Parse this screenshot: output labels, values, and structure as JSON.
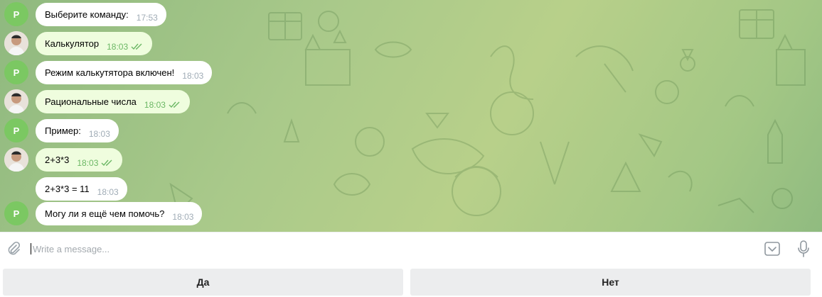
{
  "chat": {
    "messages": [
      {
        "from": "bot",
        "avatar_letter": "P",
        "text": "Выберите команду:",
        "time": "17:53"
      },
      {
        "from": "user",
        "text": "Калькулятор",
        "time": "18:03",
        "status": "read"
      },
      {
        "from": "bot",
        "avatar_letter": "P",
        "text": "Режим калькутятора включен!",
        "time": "18:03"
      },
      {
        "from": "user",
        "text": "Рациональные числа",
        "time": "18:03",
        "status": "read"
      },
      {
        "from": "bot",
        "avatar_letter": "P",
        "text": "Пример:",
        "time": "18:03"
      },
      {
        "from": "user",
        "text": "2+3*3",
        "time": "18:03",
        "status": "read"
      },
      {
        "from": "bot",
        "avatar_letter": "",
        "text": "2+3*3 = 11",
        "time": "18:03"
      },
      {
        "from": "bot",
        "avatar_letter": "P",
        "text": "Могу ли я ещё чем помочь?",
        "time": "18:03"
      }
    ]
  },
  "composer": {
    "placeholder": "Write a message...",
    "value": ""
  },
  "reply_keyboard": {
    "buttons": [
      {
        "label": "Да"
      },
      {
        "label": "Нет"
      }
    ]
  },
  "icons": {
    "attach": "paperclip-icon",
    "keyboard_toggle": "chevron-down-icon",
    "voice": "microphone-icon",
    "read_status": "double-check-icon"
  },
  "colors": {
    "bot_avatar": "#7bc862",
    "outgoing_bubble": "#effdde",
    "incoming_bubble": "#ffffff",
    "read_check": "#6cb865",
    "wallpaper": "#a9c98a"
  }
}
